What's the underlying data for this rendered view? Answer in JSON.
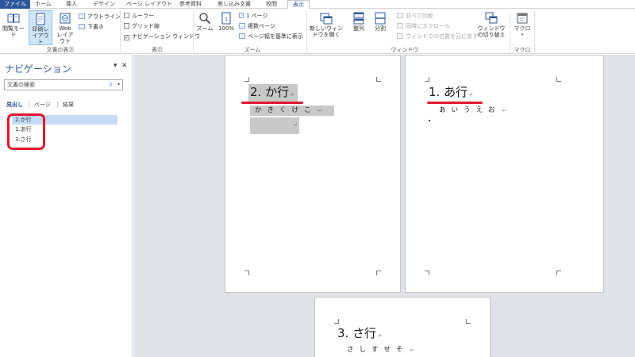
{
  "tabs": [
    {
      "label": "ファイル"
    },
    {
      "label": "ホーム"
    },
    {
      "label": "挿入"
    },
    {
      "label": "デザイン"
    },
    {
      "label": "ページ レイアウト"
    },
    {
      "label": "参考資料"
    },
    {
      "label": "差し込み文書"
    },
    {
      "label": "校閲"
    },
    {
      "label": "表示"
    }
  ],
  "ribbon": {
    "views": {
      "read_mode": "閲覧モード",
      "print_layout": "印刷レイアウト",
      "web_layout": "Webレイアウト",
      "outline": "アウトライン",
      "draft": "下書き",
      "group_label": "文書の表示"
    },
    "show": {
      "ruler": "ルーラー",
      "gridlines": "グリッド線",
      "nav_pane": "ナビゲーション ウィンドウ",
      "group_label": "表示",
      "nav_pane_checked": "✓"
    },
    "zoom": {
      "zoom": "ズーム",
      "percent": "100%",
      "one_page": "1 ページ",
      "multi_page": "複数ページ",
      "page_width": "ページ幅を基準に表示",
      "group_label": "ズーム"
    },
    "window": {
      "new_window": "新しいウィンドウを開く",
      "arrange": "整列",
      "split": "分割",
      "side_by_side": "並べて比較",
      "sync_scroll": "同時にスクロール",
      "reset_pos": "ウィンドウの位置を元に戻す",
      "switch": "ウィンドウの切り替え",
      "group_label": "ウィンドウ"
    },
    "macro": {
      "macro": "マクロ",
      "group_label": "マクロ"
    }
  },
  "nav": {
    "title": "ナビゲーション",
    "dropdown_glyph": "▾",
    "close_glyph": "✕",
    "search_placeholder": "文書の検索",
    "search_glyph": "⌕",
    "tabs": {
      "headings": "見出し",
      "pages": "ページ",
      "results": "結果"
    },
    "headings": [
      {
        "label": "2.か行"
      },
      {
        "label": "1.あ行"
      },
      {
        "label": "3.さ行"
      }
    ]
  },
  "document": {
    "pages": [
      {
        "heading": "2. か行",
        "body": "かきくけこ",
        "mark": "↵"
      },
      {
        "heading": "1. あ行",
        "body": "あいうえお",
        "mark": "↵"
      },
      {
        "heading": "3. さ行",
        "body": "さしすせそ",
        "mark": "↵"
      }
    ],
    "empty_mark": "↵"
  },
  "colors": {
    "file_tab": "#2b579a",
    "accent": "#2b579a",
    "annotation_red": "#e0182f",
    "selection_gray": "#c8c8c8",
    "nav_selected": "#c5daf4",
    "doc_background": "#dfe3e8"
  },
  "icons": {
    "read_mode": "book-icon",
    "print_layout": "page-icon",
    "web_layout": "globe-icon",
    "zoom": "magnifier-icon",
    "new_window": "window-icon",
    "macro": "macro-icon"
  }
}
